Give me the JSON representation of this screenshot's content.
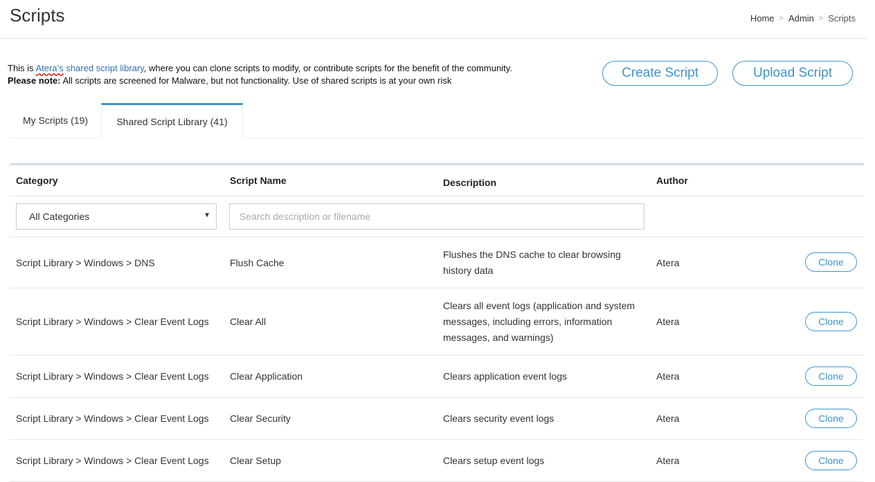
{
  "header": {
    "title": "Scripts",
    "breadcrumb": [
      {
        "label": "Home"
      },
      {
        "label": "Admin"
      },
      {
        "label": "Scripts"
      }
    ],
    "separator": ">"
  },
  "intro": {
    "prefix": "This is ",
    "link_word": "Atera’s",
    "link_rest": " shared script library",
    "suffix": ", where you can clone scripts to modify, or contribute scripts for the benefit of the community.",
    "note_label": "Please note:",
    "note_text": " All scripts are screened for Malware, but not functionality. Use of shared scripts is at your own risk"
  },
  "actions": {
    "create_label": "Create Script",
    "upload_label": "Upload Script"
  },
  "tabs": [
    {
      "label": "My Scripts (19)",
      "active": false
    },
    {
      "label": "Shared Script Library (41)",
      "active": true
    }
  ],
  "table": {
    "columns": [
      "Category",
      "Script Name",
      "Description",
      "Author"
    ],
    "filter": {
      "category_selected": "All Categories",
      "search_placeholder": "Search description or filename"
    },
    "clone_label": "Clone",
    "rows": [
      {
        "category": "Script Library > Windows > DNS",
        "name": "Flush Cache",
        "description": "Flushes the DNS cache to clear browsing history data",
        "author": "Atera"
      },
      {
        "category": "Script Library > Windows > Clear Event Logs",
        "name": "Clear All",
        "description": "Clears all event logs (application and system messages, including errors, information messages, and warnings)",
        "author": "Atera"
      },
      {
        "category": "Script Library > Windows > Clear Event Logs",
        "name": "Clear Application",
        "description": "Clears application event logs",
        "author": "Atera"
      },
      {
        "category": "Script Library > Windows > Clear Event Logs",
        "name": "Clear Security",
        "description": "Clears security event logs",
        "author": "Atera"
      },
      {
        "category": "Script Library > Windows > Clear Event Logs",
        "name": "Clear Setup",
        "description": "Clears setup event logs",
        "author": "Atera"
      }
    ]
  },
  "colors": {
    "accent": "#3d94cf",
    "link": "#2f6fb5"
  }
}
